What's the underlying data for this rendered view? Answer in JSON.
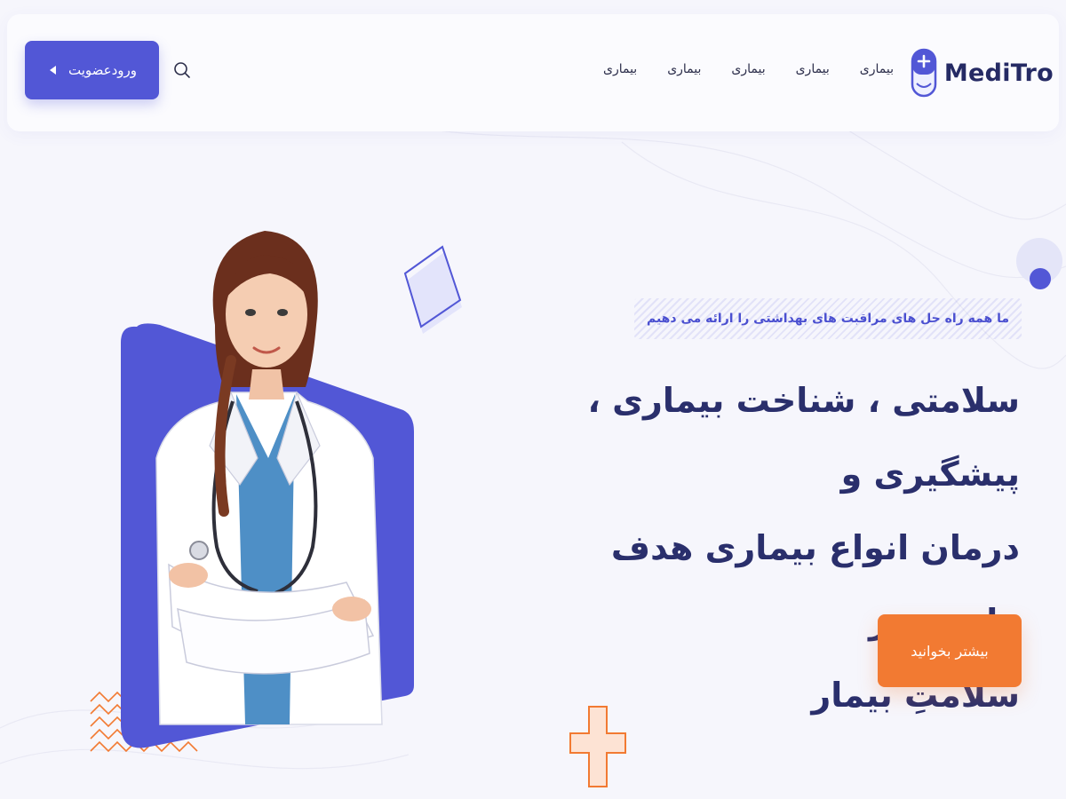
{
  "brand": {
    "name": "MediTro",
    "accent": "#5257d6",
    "dark": "#252a64",
    "orange": "#f27a32"
  },
  "header": {
    "login_label": "ورود‌عضویت",
    "nav": [
      "بیماری",
      "بیماری",
      "بیماری",
      "بیماری",
      "بیماری"
    ],
    "icons": {
      "search": "search-icon",
      "logo": "logo-icon",
      "login_arrow": "arrow-left-icon"
    }
  },
  "hero": {
    "tagline": "ما همه راه حل های مراقبت های بهداشتی را ارائه می دهیم",
    "headline_lines": [
      "سلامتی ، شناخت بیماری ، پیشگیری و",
      "درمان انواع بیماری هدف ماست در",
      "سلامتِ بیمار"
    ],
    "cta_label": "بیشتر بخوانید",
    "image": "doctor-photo"
  }
}
